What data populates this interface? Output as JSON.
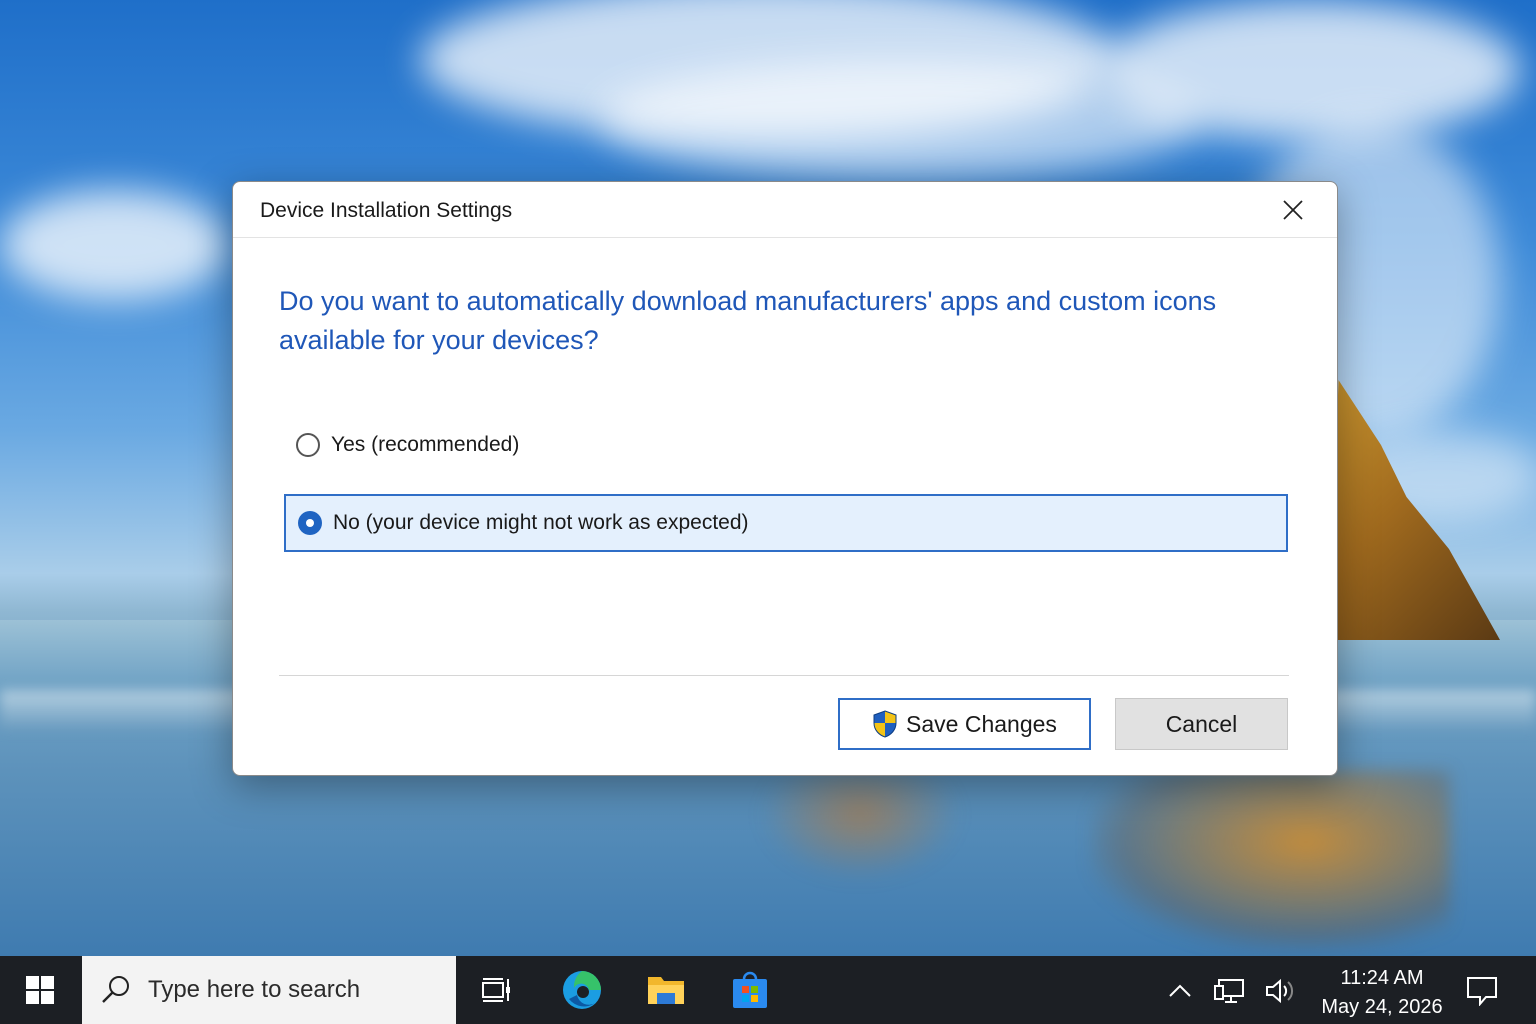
{
  "dialog": {
    "title": "Device Installation Settings",
    "question": "Do you want to automatically download manufacturers' apps and custom icons available for your devices?",
    "options": [
      {
        "label": "Yes (recommended)",
        "selected": false
      },
      {
        "label": "No (your device might not work as expected)",
        "selected": true
      }
    ],
    "save_label": "Save Changes",
    "cancel_label": "Cancel"
  },
  "taskbar": {
    "search_placeholder": "Type here to search",
    "pinned_icons": [
      "task-view-icon",
      "edge-icon",
      "file-explorer-icon",
      "store-icon"
    ],
    "tray_icons": [
      "chevron-up-icon",
      "network-icon",
      "volume-icon",
      "notification-icon"
    ],
    "time": "11:24 AM",
    "date": "May 24, 2026"
  },
  "colors": {
    "accent": "#1f64c2",
    "question_text": "#1f57b8",
    "selected_bg": "#e4f0fd",
    "taskbar_bg": "#1c1f24"
  }
}
